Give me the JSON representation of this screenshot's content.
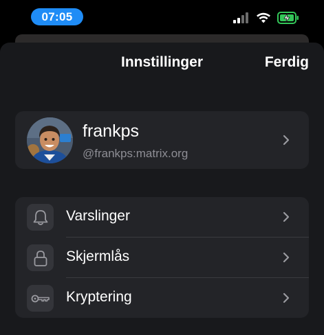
{
  "status_bar": {
    "time": "07:05",
    "accent_color": "#1f8cf6",
    "icons": [
      "cellular-signal-icon",
      "wifi-icon",
      "battery-charging-icon"
    ],
    "battery_color": "#34c759"
  },
  "nav": {
    "title": "Innstillinger",
    "done_label": "Ferdig"
  },
  "profile": {
    "name": "frankps",
    "user_id": "@frankps:matrix.org",
    "avatar_icon": "avatar"
  },
  "settings": {
    "items": [
      {
        "label": "Varslinger",
        "icon": "bell-icon"
      },
      {
        "label": "Skjermlås",
        "icon": "lock-icon"
      },
      {
        "label": "Kryptering",
        "icon": "key-icon"
      }
    ]
  },
  "colors": {
    "background": "#000000",
    "sheet": "#18191c",
    "card": "#232428",
    "icon_box": "#34353a",
    "secondary_text": "#8e8e95"
  }
}
